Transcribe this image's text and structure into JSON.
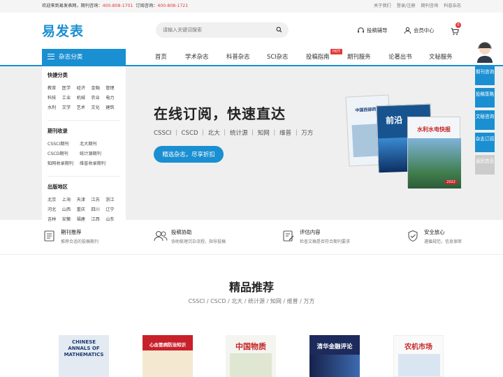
{
  "topbar": {
    "welcome": "欢迎来到易发表网，期刊咨询：",
    "phone1": "400-808-1701",
    "order_label": "订阅咨询：",
    "phone2": "400-808-1721",
    "links": [
      "关于我们",
      "登录/注册",
      "期刊咨询",
      "科普杂志"
    ]
  },
  "header": {
    "logo": "易发表",
    "search_placeholder": "请输入关键词搜索",
    "submit_help": "投稿辅导",
    "member": "会员中心",
    "cart_count": "0"
  },
  "nav": {
    "category": "杂志分类",
    "items": [
      "首页",
      "学术杂志",
      "科普杂志",
      "SCI杂志",
      "投稿指南",
      "期刊服务",
      "论著出书",
      "文秘服务"
    ],
    "hot_badge": "HOT"
  },
  "sidepanel": {
    "quick": {
      "title": "快捷分类",
      "rows": [
        [
          "教育",
          "医学",
          "经济",
          "金融",
          "管理"
        ],
        [
          "科技",
          "工业",
          "机械",
          "农业",
          "电力"
        ],
        [
          "水利",
          "文学",
          "艺术",
          "文化",
          "建筑"
        ]
      ]
    },
    "index": {
      "title": "期刊收录",
      "rows": [
        [
          "CSSCI期刊",
          "北大期刊"
        ],
        [
          "CSCD期刊",
          "统计源期刊"
        ],
        [
          "知网收录期刊",
          "维普收录期刊"
        ]
      ]
    },
    "region": {
      "title": "出版地区",
      "rows": [
        [
          "北京",
          "上海",
          "天津",
          "江苏",
          "浙江"
        ],
        [
          "河北",
          "山西",
          "重庆",
          "四川",
          "辽宁"
        ],
        [
          "吉林",
          "安徽",
          "福建",
          "江西",
          "山东"
        ]
      ]
    }
  },
  "hero": {
    "title": "在线订阅，快速直达",
    "tags": "CSSCI ｜ CSCD ｜ 北大 ｜ 统计源 ｜ 知网 ｜ 维普 ｜ 万方",
    "button": "精选杂志，尽享折扣",
    "mag1": "中国西部药学",
    "mag2": "前沿",
    "mag3": "水利水电快报",
    "mag3_year": "2022"
  },
  "float": {
    "items": [
      "期刊咨询",
      "投稿策略",
      "文秘咨询",
      "杂志订阅",
      "返回首页"
    ]
  },
  "features": [
    {
      "title": "期刊推荐",
      "desc": "推荐合适的投稿期刊"
    },
    {
      "title": "投稿协助",
      "desc": "协助梳理沉杂流程，指导投稿"
    },
    {
      "title": "评估内容",
      "desc": "检查文稿是否符合期刊要求"
    },
    {
      "title": "安全放心",
      "desc": "遵循规范，信息保密"
    }
  ],
  "recommend": {
    "title": "精品推荐",
    "subtitle": "CSSCI / CSCD / 北大 / 统计源 / 知网 / 维普 / 万方",
    "covers": [
      {
        "title": "CHINESE ANNALS OF MATHEMATICS",
        "color": "#e3eaf2"
      },
      {
        "title": "心血管病防治知识",
        "color": "#c8202a"
      },
      {
        "title": "中国物质",
        "color": "#f4f4f0"
      },
      {
        "title": "清华金融评论",
        "color": "#1d2a5c"
      },
      {
        "title": "农机市场",
        "color": "#fafafa"
      }
    ]
  },
  "colors": {
    "accent": "#1a8fd1",
    "hot": "#e4393c"
  }
}
